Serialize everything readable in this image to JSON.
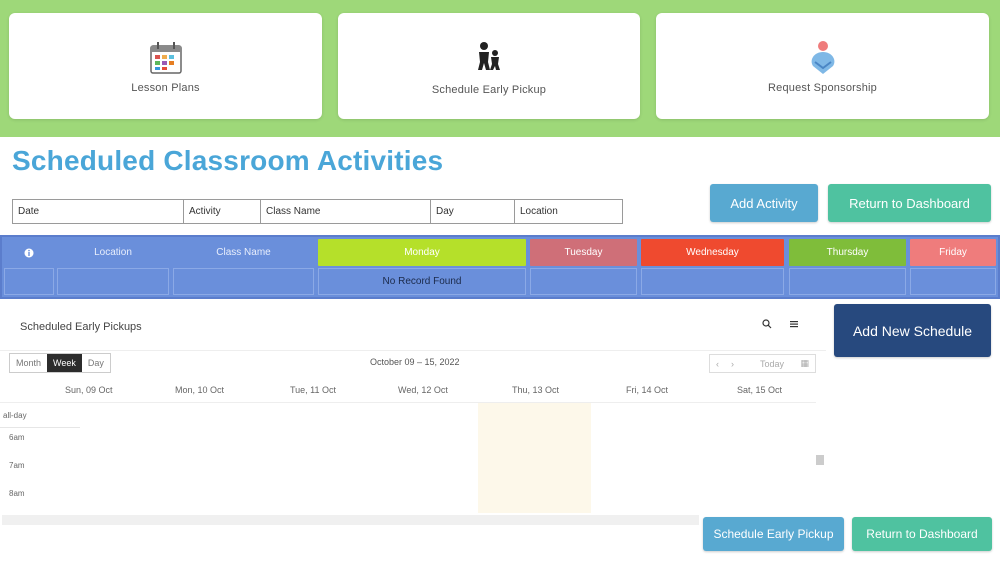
{
  "top_cards": [
    {
      "label": "Lesson Plans",
      "icon": "calendar-icon"
    },
    {
      "label": "Schedule Early Pickup",
      "icon": "parent-child-icon"
    },
    {
      "label": "Request Sponsorship",
      "icon": "hands-heart-icon"
    }
  ],
  "title": "Scheduled Classroom Activities",
  "filters": [
    "Date",
    "Activity",
    "Class Name",
    "Day",
    "Location"
  ],
  "buttons": {
    "add_activity": "Add Activity",
    "return_dashboard": "Return to Dashboard",
    "add_new_schedule": "Add New Schedule",
    "schedule_early_pickup": "Schedule Early Pickup",
    "return_dashboard_bottom": "Return to Dashboard"
  },
  "grid": {
    "headers": [
      "Location",
      "Class Name"
    ],
    "days": [
      "Monday",
      "Tuesday",
      "Wednesday",
      "Thursday",
      "Friday"
    ],
    "day_colors": [
      "#b5e02a",
      "#cf6f78",
      "#ef4a2f",
      "#7fbd3a",
      "#ef7c7c"
    ],
    "empty_message": "No Record Found"
  },
  "calendar": {
    "title": "Scheduled Early Pickups",
    "views": [
      "Month",
      "Week",
      "Day"
    ],
    "active_view": "Week",
    "range": "October 09 – 15, 2022",
    "today_label": "Today",
    "days": [
      "Sun, 09 Oct",
      "Mon, 10 Oct",
      "Tue, 11 Oct",
      "Wed, 12 Oct",
      "Thu, 13 Oct",
      "Fri, 14 Oct",
      "Sat, 15 Oct"
    ],
    "times": [
      "all-day",
      "6am",
      "7am",
      "8am"
    ]
  },
  "colors": {
    "band": "#9ed879",
    "title": "#4aa6d8",
    "grid": "#6a8fdb",
    "btn_blue": "#58a9d1",
    "btn_green": "#4fc2a0",
    "btn_navy": "#27497e"
  }
}
